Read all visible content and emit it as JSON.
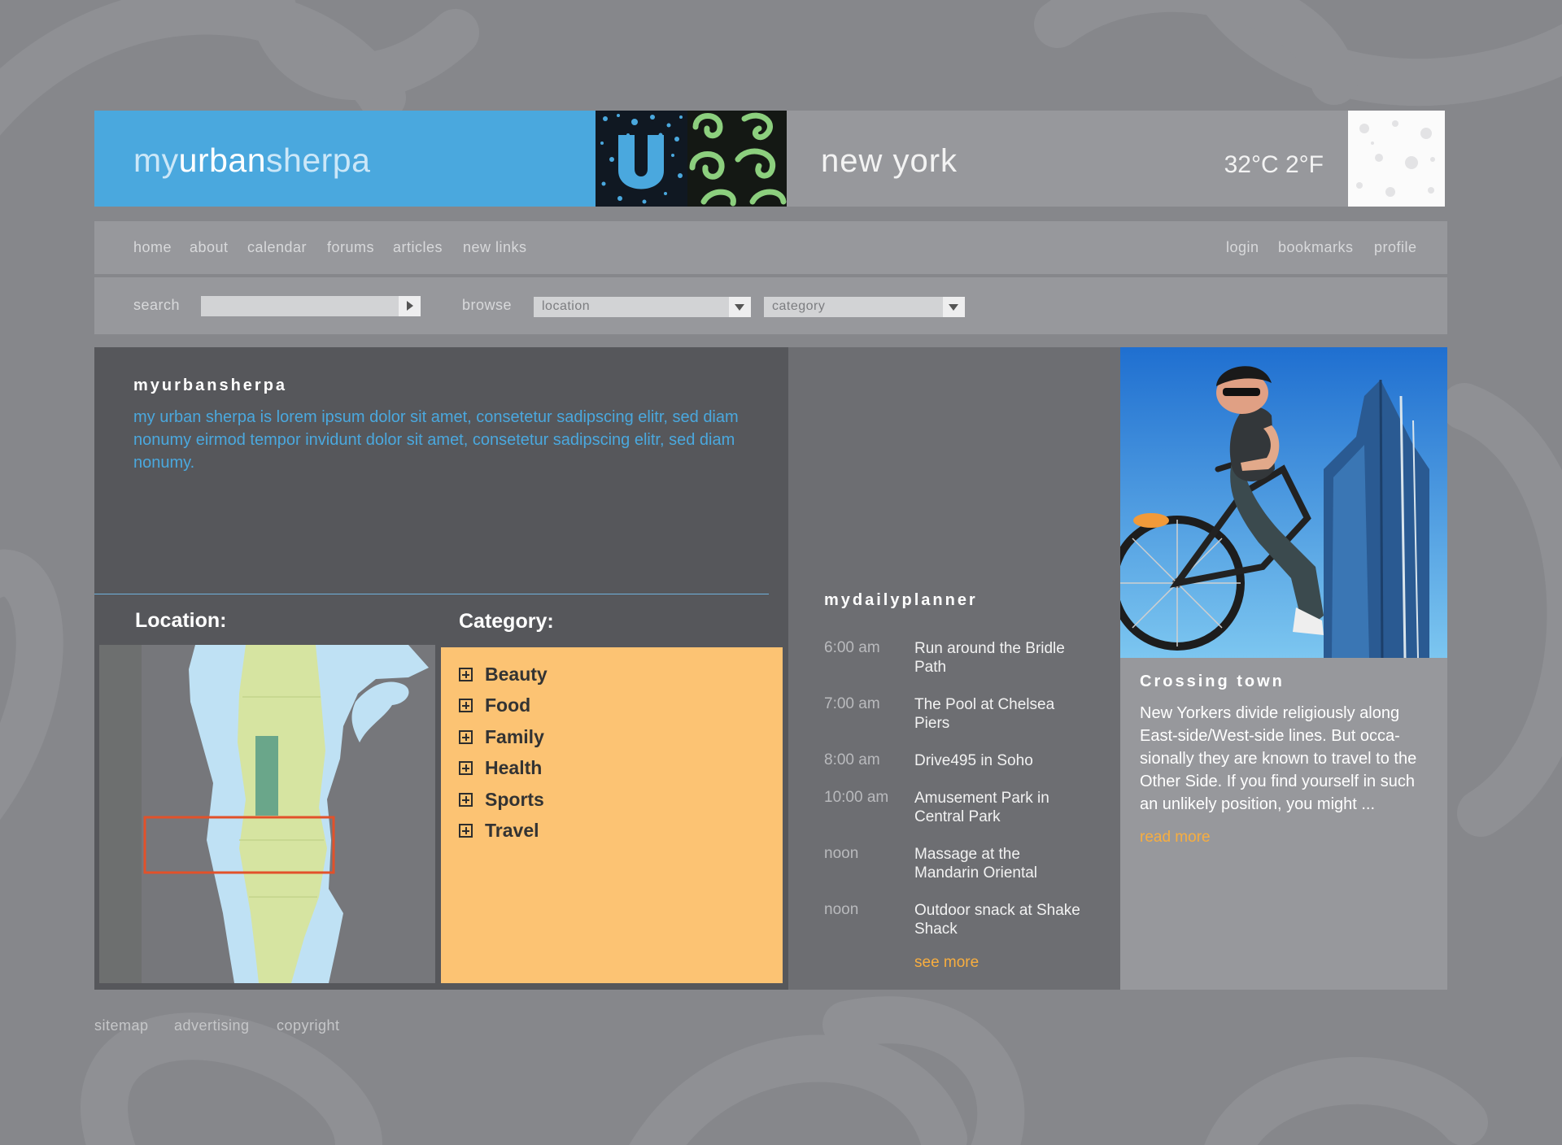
{
  "header": {
    "logo": {
      "part1": "my",
      "part2": "urban",
      "part3": "sherpa"
    },
    "city": "new york",
    "temperature": "32°C 2°F"
  },
  "nav": {
    "left": [
      "home",
      "about",
      "calendar",
      "forums",
      "articles",
      "new links"
    ],
    "right": [
      "login",
      "bookmarks",
      "profile"
    ]
  },
  "search": {
    "label": "search",
    "value": "",
    "browse_label": "browse",
    "location_value": "location",
    "category_value": "category"
  },
  "intro": {
    "heading": "myurbansherpa",
    "text": "my urban sherpa is lorem ipsum dolor sit amet, consetetur sadipscing elitr,  sed diam nonumy eirmod tempor invidunt dolor sit amet, consetetur sadipscing elitr, sed diam nonumy."
  },
  "location": {
    "heading": "Location:"
  },
  "category": {
    "heading": "Category:",
    "items": [
      "Beauty",
      "Food",
      "Family",
      "Health",
      "Sports",
      "Travel"
    ]
  },
  "planner": {
    "heading": "mydailyplanner",
    "items": [
      {
        "time": "6:00 am",
        "event": "Run around the Bridle Path"
      },
      {
        "time": "7:00 am",
        "event": "The Pool at Chelsea Piers"
      },
      {
        "time": "8:00 am",
        "event": "Drive495 in Soho"
      },
      {
        "time": "10:00 am",
        "event": "Amusement Park in Central Park"
      },
      {
        "time": "noon",
        "event": "Massage at the Mandarin Oriental"
      },
      {
        "time": "noon",
        "event": "Outdoor snack at Shake Shack"
      }
    ],
    "see_more": "see more"
  },
  "feature": {
    "heading": "Crossing town",
    "text": "New Yorkers divide religiously along East-side/West-side lines. But occa-sionally they are known to travel to the Other Side. If you find yourself in such an unlikely position, you might ...",
    "read_more": "read more"
  },
  "footer": {
    "links": [
      "sitemap",
      "advertising",
      "copyright"
    ]
  },
  "colors": {
    "background": "#86878b",
    "header_blue": "#4aa8de",
    "panel_dark": "#56575b",
    "planner": "#6d6e72",
    "category_box": "#fcc373",
    "link_orange": "#f8ae3f",
    "map_water": "#bfe1f4",
    "map_land": "#d6e4a1",
    "map_selection": "#e2512a"
  },
  "icons": [
    "search-submit-arrow-icon",
    "dropdown-arrow-icon",
    "expand-plus-icon"
  ]
}
